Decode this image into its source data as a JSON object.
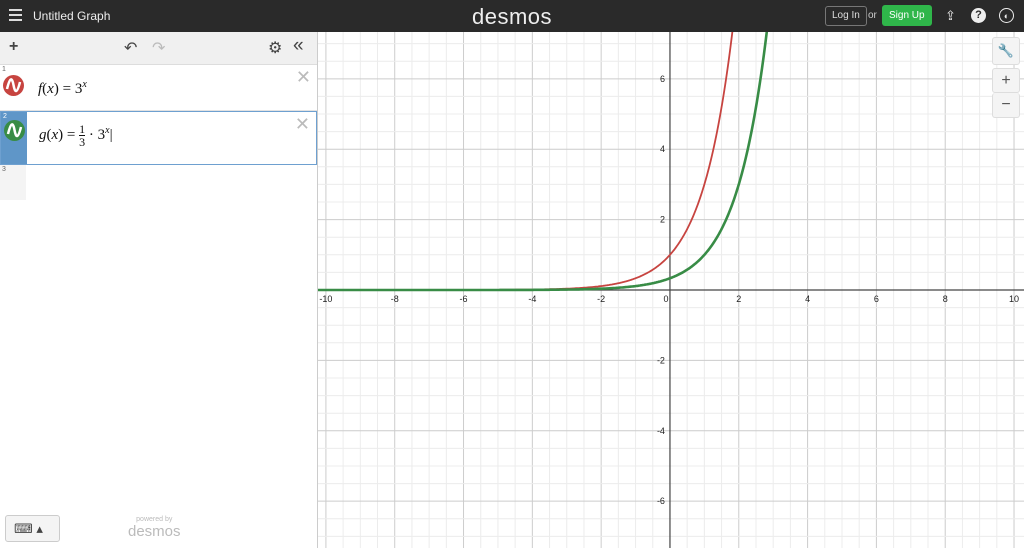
{
  "topbar": {
    "title": "Untitled Graph",
    "logo": "desmos",
    "login": "Log In",
    "or": "or",
    "signup": "Sign Up",
    "icons": [
      "share-icon",
      "help-icon",
      "globe-icon"
    ]
  },
  "toolbar": {
    "add": "+",
    "undo": "↶",
    "redo": "↷",
    "settings": "⚙",
    "collapse": "«"
  },
  "expressions": [
    {
      "num": "1",
      "name": "f",
      "var": "x",
      "base": "3",
      "exp": "x",
      "color": "#c74440"
    },
    {
      "num": "2",
      "name": "g",
      "var": "x",
      "coef_num": "1",
      "coef_den": "3",
      "base": "3",
      "exp": "x",
      "color": "#388c46"
    },
    {
      "num": "3"
    }
  ],
  "footer": {
    "keyboard": "⌨ ▴",
    "powered_by": "powered by",
    "brand": "desmos"
  },
  "graph_controls": {
    "wrench": "🔧",
    "zoom_in": "+",
    "zoom_out": "−"
  },
  "chart_data": {
    "type": "line",
    "xlim": [
      -10.23,
      10.29
    ],
    "ylim": [
      -7.33,
      7.33
    ],
    "x_ticks": [
      -10,
      -8,
      -6,
      -4,
      -2,
      0,
      2,
      4,
      6,
      8,
      10
    ],
    "y_ticks": [
      -6,
      -4,
      -2,
      2,
      4,
      6
    ],
    "grid": true,
    "major_step": 2,
    "minor_step": 0.5,
    "series": [
      {
        "name": "f(x) = 3^x",
        "coef": 1,
        "base": 3,
        "color": "#c74440"
      },
      {
        "name": "g(x) = 1/3 · 3^x",
        "coef": 0.3333,
        "base": 3,
        "color": "#388c46"
      }
    ]
  }
}
